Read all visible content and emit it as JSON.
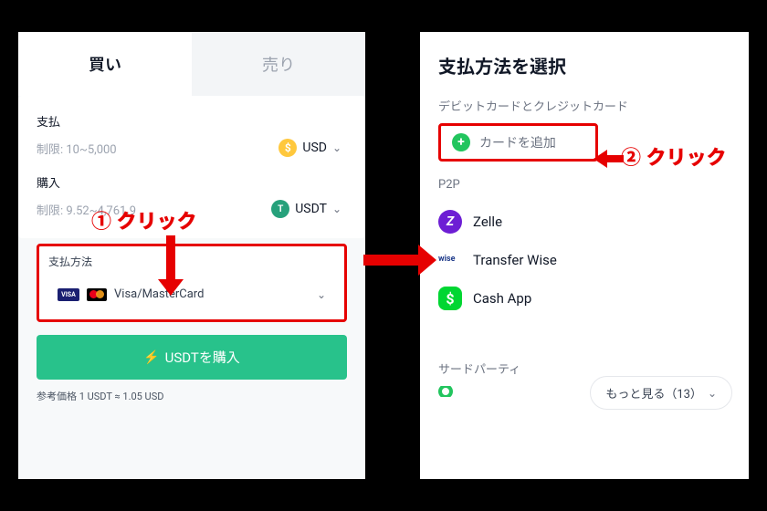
{
  "left": {
    "tab_buy": "買い",
    "tab_sell": "売り",
    "pay_label": "支払",
    "pay_limit": "制限: 10~5,000",
    "pay_currency": "USD",
    "buy_label": "購入",
    "buy_limit": "制限: 9.52~4,761.9",
    "buy_currency": "USDT",
    "payment_method_label": "支払方法",
    "payment_method_value": "Visa/MasterCard",
    "cta": "USDTを購入",
    "ref_price": "参考価格 1 USDT ≈ 1.05 USD"
  },
  "right": {
    "title": "支払方法を選択",
    "section_debit": "デビットカードとクレジットカード",
    "add_card": "カードを追加",
    "section_p2p": "P2P",
    "p2p_items": [
      {
        "name": "Zelle"
      },
      {
        "name": "Transfer Wise"
      },
      {
        "name": "Cash App"
      }
    ],
    "more": "もっと見る（13）",
    "section_third": "サードパーティ"
  },
  "annot": {
    "step1": "① クリック",
    "step2": "② クリック"
  }
}
